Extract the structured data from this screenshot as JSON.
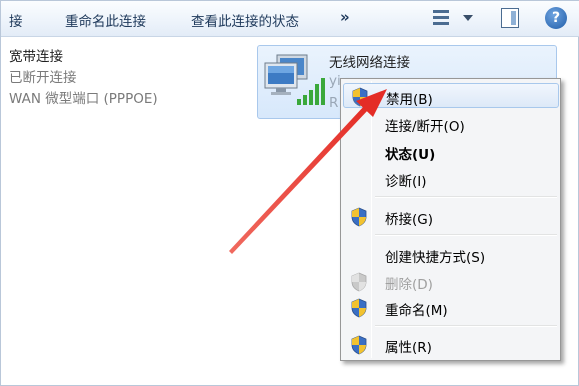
{
  "toolbar": {
    "item_partial": "接",
    "rename": "重命名此连接",
    "view_status": "查看此连接的状态",
    "more": "»",
    "help": "?"
  },
  "broadband": {
    "name": "宽带连接",
    "status": "已断开连接",
    "device": "WAN 微型端口 (PPPOE)"
  },
  "wireless": {
    "name": "无线网络连接",
    "line2": "yi",
    "line3": "R"
  },
  "context_menu": {
    "items": [
      {
        "label": "禁用(B)",
        "shield": true
      },
      {
        "label": "连接/断开(O)",
        "shield": false
      },
      {
        "label": "状态(U)",
        "shield": false
      },
      {
        "label": "诊断(I)",
        "shield": false
      },
      {
        "label": "桥接(G)",
        "shield": true
      },
      {
        "label": "创建快捷方式(S)",
        "shield": false
      },
      {
        "label": "删除(D)",
        "shield": true
      },
      {
        "label": "重命名(M)",
        "shield": true
      },
      {
        "label": "属性(R)",
        "shield": true
      }
    ]
  },
  "colors": {
    "arrow": "#e8322d",
    "menu_hover": "#dde9f8",
    "toolbar_text": "#1e395b"
  }
}
